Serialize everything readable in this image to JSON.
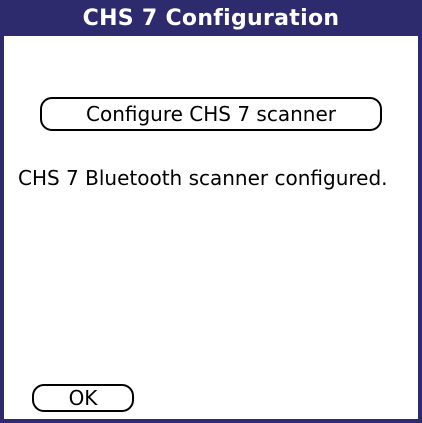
{
  "window": {
    "title": "CHS 7 Configuration"
  },
  "main": {
    "configure_button_label": "Configure CHS 7 scanner",
    "status_message": "CHS 7 Bluetooth scanner configured."
  },
  "footer": {
    "ok_label": "OK"
  },
  "colors": {
    "title_bar": "#2e2a6e",
    "title_text": "#ffffff",
    "background": "#ffffff",
    "text": "#000000"
  }
}
